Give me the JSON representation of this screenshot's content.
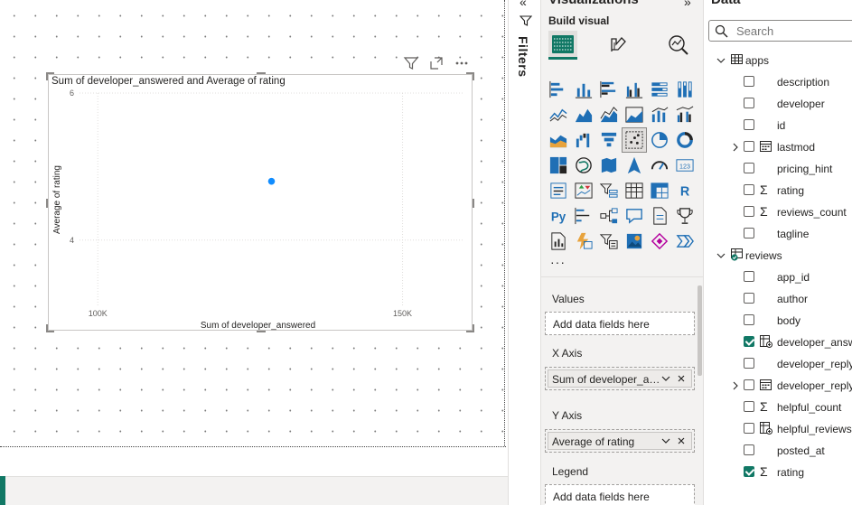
{
  "canvas": {
    "visual": {
      "title": "Sum of developer_answered and Average of rating",
      "header_icons": [
        "filter-icon",
        "focus-mode-icon",
        "more-options-icon"
      ]
    }
  },
  "chart_data": {
    "type": "scatter",
    "title": "Sum of developer_answered and Average of rating",
    "xlabel": "Sum of developer_answered",
    "ylabel": "Average of rating",
    "xlim": [
      97000,
      160000
    ],
    "ylim": [
      3.1,
      6.0
    ],
    "x_ticks": [
      {
        "value": 100000,
        "label": "100K"
      },
      {
        "value": 150000,
        "label": "150K"
      }
    ],
    "y_ticks": [
      {
        "value": 6,
        "label": "6"
      },
      {
        "value": 4,
        "label": "4"
      }
    ],
    "points": [
      {
        "x": 128500,
        "y": 4.8
      }
    ],
    "point_color": "#118DFF",
    "grid": true,
    "legend": "none"
  },
  "filters_pane": {
    "label": "Filters"
  },
  "visualizations_pane": {
    "title": "Visualizations",
    "build_visual": "Build visual",
    "tabs": [
      "build-visual-icon",
      "format-visual-icon",
      "analytics-icon"
    ],
    "more": "···",
    "wells": [
      {
        "label": "Values",
        "placeholder": "Add data fields here"
      },
      {
        "label": "X Axis",
        "field": "Sum of developer_ans..."
      },
      {
        "label": "Y Axis",
        "field": "Average of rating"
      },
      {
        "label": "Legend",
        "placeholder": "Add data fields here"
      }
    ]
  },
  "data_pane": {
    "title": "Data",
    "search_placeholder": "Search",
    "tables": [
      {
        "name": "apps",
        "expanded": true,
        "fields": [
          {
            "name": "description",
            "type": "",
            "checked": false
          },
          {
            "name": "developer",
            "type": "",
            "checked": false
          },
          {
            "name": "id",
            "type": "",
            "checked": false
          },
          {
            "name": "lastmod",
            "type": "calendar",
            "checked": false,
            "expandable": true
          },
          {
            "name": "pricing_hint",
            "type": "",
            "checked": false
          },
          {
            "name": "rating",
            "type": "sigma",
            "checked": false
          },
          {
            "name": "reviews_count",
            "type": "sigma",
            "checked": false
          },
          {
            "name": "tagline",
            "type": "",
            "checked": false
          }
        ]
      },
      {
        "name": "reviews",
        "expanded": true,
        "fields": [
          {
            "name": "app_id",
            "type": "",
            "checked": false
          },
          {
            "name": "author",
            "type": "",
            "checked": false
          },
          {
            "name": "body",
            "type": "",
            "checked": false
          },
          {
            "name": "developer_answered",
            "type": "calc",
            "checked": true
          },
          {
            "name": "developer_reply",
            "type": "",
            "checked": false
          },
          {
            "name": "developer_reply_date",
            "type": "calendar",
            "checked": false,
            "expandable": true
          },
          {
            "name": "helpful_count",
            "type": "sigma",
            "checked": false
          },
          {
            "name": "helpful_reviews",
            "type": "calc",
            "checked": false
          },
          {
            "name": "posted_at",
            "type": "",
            "checked": false
          },
          {
            "name": "rating",
            "type": "sigma",
            "checked": true
          }
        ]
      }
    ]
  }
}
